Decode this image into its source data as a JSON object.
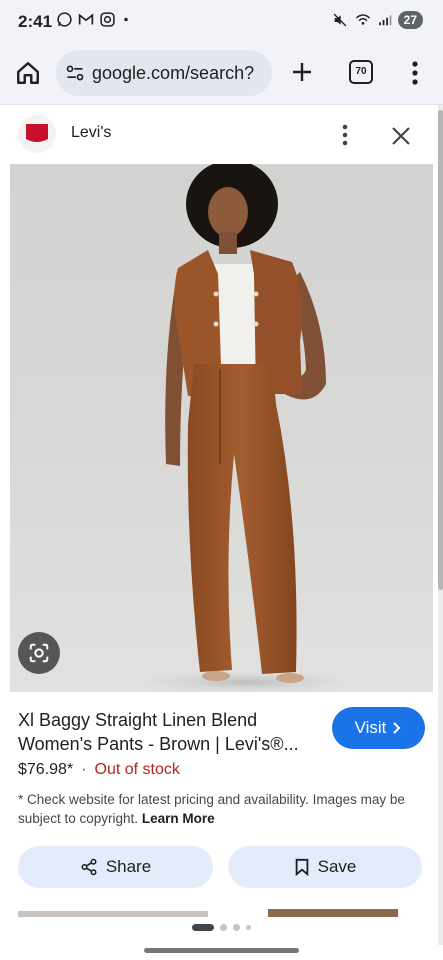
{
  "status_bar": {
    "time": "2:41",
    "battery": "27",
    "left_icons": [
      "whatsapp-icon",
      "gmail-icon",
      "instagram-icon",
      "dot-icon"
    ],
    "right_icons": [
      "mute-icon",
      "wifi-icon",
      "signal-icon",
      "battery-icon"
    ]
  },
  "browser": {
    "url": "google.com/search?",
    "tab_count": "70"
  },
  "sheet": {
    "brand": "Levi's",
    "brand_color": "#c8102e"
  },
  "product": {
    "title": "Xl Baggy Straight Linen Blend Women's Pants - Brown | Levi's®...",
    "price": "$76.98*",
    "separator": "·",
    "stock_status": "Out of stock",
    "visit_label": "Visit",
    "disclaimer": "* Check website for latest pricing and availability. Images may be subject to copyright.",
    "learn_more": "Learn More"
  },
  "actions": {
    "share_label": "Share",
    "save_label": "Save"
  },
  "colors": {
    "accent": "#1a73e8",
    "out_of_stock": "#b3261e",
    "button_bg": "#e4ecfb",
    "garment": "#9a5528"
  }
}
